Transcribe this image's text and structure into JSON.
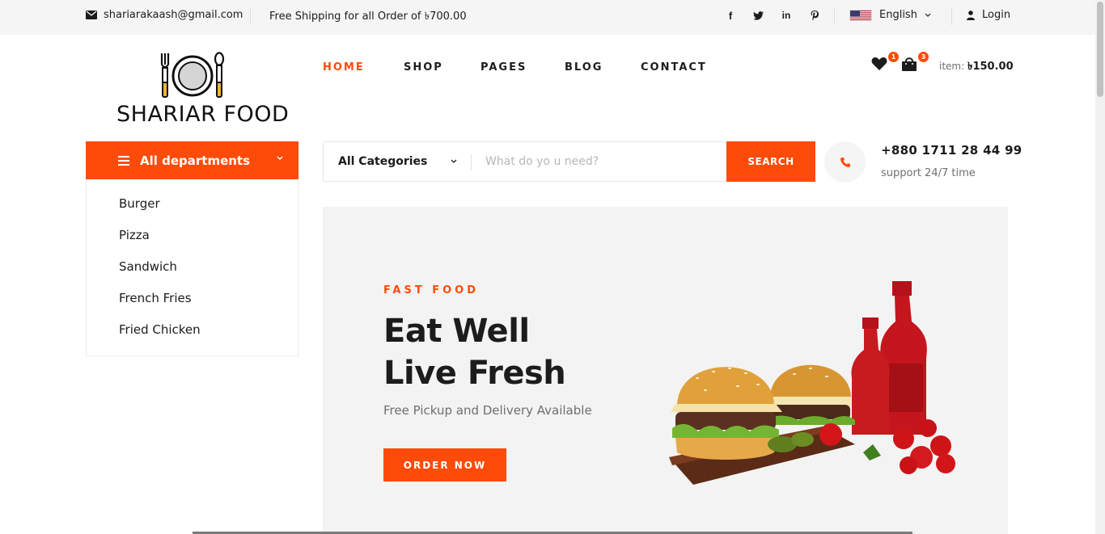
{
  "topbar": {
    "email": "shariarakaash@gmail.com",
    "shipping": "Free Shipping for all Order of ৳700.00",
    "social": [
      "facebook-icon",
      "twitter-icon",
      "linkedin-icon",
      "pinterest-icon"
    ],
    "language": "English",
    "login": "Login"
  },
  "logo": {
    "text": "SHARIAR FOOD"
  },
  "nav": [
    {
      "label": "HOME",
      "active": true
    },
    {
      "label": "SHOP"
    },
    {
      "label": "PAGES"
    },
    {
      "label": "BLOG"
    },
    {
      "label": "CONTACT"
    }
  ],
  "header": {
    "wishlist_count": "1",
    "cart_count": "3",
    "item_label": "item:",
    "item_total": "৳150.00"
  },
  "departments": {
    "title": "All departments",
    "items": [
      "Burger",
      "Pizza",
      "Sandwich",
      "French Fries",
      "Fried Chicken"
    ]
  },
  "search": {
    "category": "All Categories",
    "placeholder": "What do yo u need?",
    "button": "SEARCH"
  },
  "contact": {
    "phone": "+880 1711 28 44 99",
    "support": "support 24/7 time"
  },
  "hero": {
    "kicker": "FAST FOOD",
    "title_line1": "Eat Well",
    "title_line2": "Live Fresh",
    "subtitle": "Free Pickup and Delivery Available",
    "button": "ORDER NOW"
  },
  "colors": {
    "accent": "#ff4b0a",
    "text": "#1c1c1c",
    "muted": "#6f6f6f",
    "hero_bg": "#f3f3f3"
  }
}
